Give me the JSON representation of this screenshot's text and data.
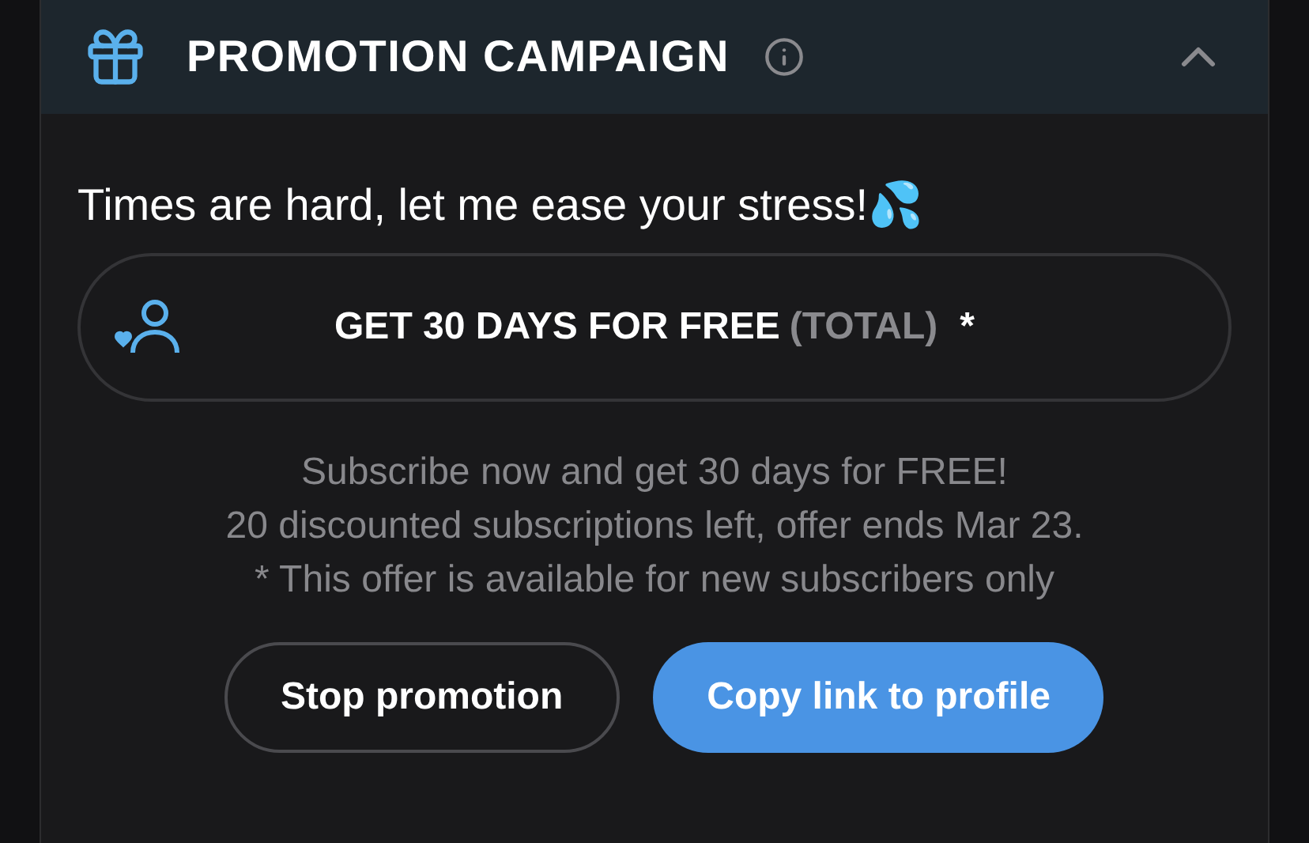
{
  "header": {
    "title": "PROMOTION CAMPAIGN",
    "expanded": true
  },
  "message": "Times are hard, let me ease your stress!💦",
  "offer": {
    "label": "GET 30 DAYS FOR FREE",
    "qualifier": "(TOTAL)",
    "mark": "*"
  },
  "description": [
    "Subscribe now and get 30 days for FREE!",
    "20 discounted subscriptions left, offer ends Mar 23.",
    "* This offer is available for new subscribers only"
  ],
  "buttons": [
    {
      "label": "Stop promotion",
      "kind": "outline"
    },
    {
      "label": "Copy link to profile",
      "kind": "primary"
    }
  ]
}
